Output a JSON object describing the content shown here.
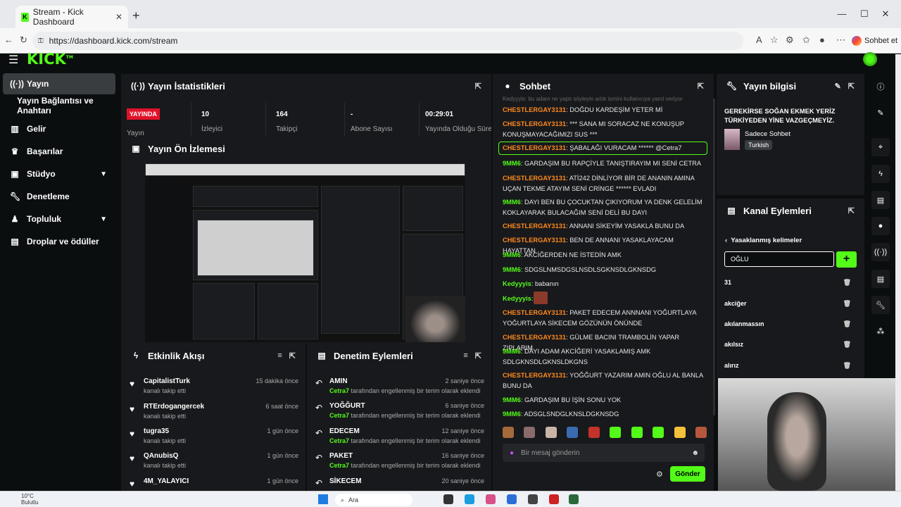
{
  "browser": {
    "tab_title": "Stream - Kick Dashboard",
    "url": "https://dashboard.kick.com/stream",
    "copilot_label": "Sohbet et"
  },
  "app": {
    "logo": "KICK"
  },
  "sidebar": {
    "items": [
      {
        "label": "Yayın",
        "icon": "broadcast-icon"
      },
      {
        "label": "Yayın Bağlantısı ve Anahtarı",
        "icon": ""
      },
      {
        "label": "Gelir",
        "icon": "revenue-icon"
      },
      {
        "label": "Başarılar",
        "icon": "trophy-icon"
      },
      {
        "label": "Stüdyo",
        "icon": "studio-icon"
      },
      {
        "label": "Denetleme",
        "icon": "wrench-icon"
      },
      {
        "label": "Topluluk",
        "icon": "community-icon"
      },
      {
        "label": "Droplar ve ödüller",
        "icon": "drops-icon"
      }
    ]
  },
  "stats": {
    "title": "Yayın İstatistikleri",
    "live_badge": "YAYINDA",
    "live_label": "Yayın",
    "items": [
      {
        "value": "10",
        "label": "İzleyici"
      },
      {
        "value": "164",
        "label": "Takipçi"
      },
      {
        "value": "-",
        "label": "Abone Sayısı"
      },
      {
        "value": "00:29:01",
        "label": "Yayında Olduğu Süre"
      }
    ]
  },
  "preview": {
    "title": "Yayın Ön İzlemesi"
  },
  "activity": {
    "title": "Etkinlik Akışı",
    "rows": [
      {
        "name": "CapitalistTurk",
        "sub": "kanalı takip etti",
        "time": "15 dakika önce"
      },
      {
        "name": "RTErdogangercek",
        "sub": "kanalı takip etti",
        "time": "6 saat önce"
      },
      {
        "name": "tugra35",
        "sub": "kanalı takip etti",
        "time": "1 gün önce"
      },
      {
        "name": "QAnubisQ",
        "sub": "kanalı takip etti",
        "time": "1 gün önce"
      },
      {
        "name": "4M_YALAYICI",
        "sub": "",
        "time": "1 gün önce"
      }
    ]
  },
  "moderation": {
    "title": "Denetim Eylemleri",
    "by": "Cetra7",
    "desc": "tarafından engellenmiş bir terim olarak eklendi",
    "rows": [
      {
        "term": "AMIN",
        "time": "2 saniye önce"
      },
      {
        "term": "YOĞĞURT",
        "time": "6 saniye önce"
      },
      {
        "term": "EDECEM",
        "time": "12 saniye önce"
      },
      {
        "term": "PAKET",
        "time": "16 saniye önce"
      },
      {
        "term": "SİKECEM",
        "time": "20 saniye önce"
      }
    ]
  },
  "chat": {
    "title": "Sohbet",
    "faded_top": "Kedyyyis: bu adam ne yaptı söyleyin artık ismini kullanıcıya yanıt veriyor",
    "messages": [
      {
        "user": "CHESTLERGAY3131",
        "color": "o",
        "text": "DOĞDU KARDEŞİM YETER Mİ"
      },
      {
        "user": "CHESTLERGAY3131",
        "color": "o",
        "text": "*** SANA MI SORACAZ NE KONUŞUP KONUŞMAYACAĞIMIZI SUS ***"
      },
      {
        "user": "CHESTLERGAY3131",
        "color": "o",
        "text": "ŞABALAĞI VURACAM ****** @Cetra7"
      },
      {
        "user": "9MM6",
        "color": "g",
        "text": "GARDAŞIM BU RAPÇİYLE TANIŞTIRAYIM MI SENİ CETRA"
      },
      {
        "user": "CHESTLERGAY3131",
        "color": "o",
        "text": "ATİ242 DİNLİYOR BİR DE ANANIN AMINA UÇAN TEKME ATAYIM SENİ CRİNGE ****** EVLADI"
      },
      {
        "user": "9MM6",
        "color": "g",
        "text": "DAYI BEN BU ÇOCUKTAN ÇIKIYORUM YA DENK GELELİM KOKLAYARAK BULACAĞIM SENİ DELİ BU DAYI"
      },
      {
        "user": "CHESTLERGAY3131",
        "color": "o",
        "text": "ANNANI SİKEYİM YASAKLA BUNU DA"
      },
      {
        "user": "CHESTLERGAY3131",
        "color": "o",
        "text": "BEN DE ANNANI YASAKLAYACAM HAYATTAN"
      },
      {
        "user": "9MM6",
        "color": "g",
        "text": "AKCİĞERDEN NE İSTEDİN AMK"
      },
      {
        "user": "9MM6",
        "color": "g",
        "text": "SDGSLNMSDGSLNSDLSGKNSDLGKNSDG"
      },
      {
        "user": "Kedyyyis",
        "color": "y",
        "text": "babanın"
      },
      {
        "user": "Kedyyyis",
        "color": "y",
        "text": ""
      },
      {
        "user": "CHESTLERGAY3131",
        "color": "o",
        "text": "PAKET EDECEM ANNNANI YOĞURTLAYA YOĞURTLAYA SİKECEM GÖZÜNÜN ÖNÜNDE"
      },
      {
        "user": "CHESTLERGAY3131",
        "color": "o",
        "text": "GÜLME BACINI TRAMBOLİN YAPAR ZIPLARIM"
      },
      {
        "user": "9MM6",
        "color": "g",
        "text": "DAYI ADAM AKCİĞERİ YASAKLAMIŞ AMK SDLGKNSDLGKNSLDKGNS"
      },
      {
        "user": "CHESTLERGAY3131",
        "color": "o",
        "text": "YOĞĞURT YAZARIM AMIN OĞLU AL BANLA BUNU DA"
      },
      {
        "user": "9MM6",
        "color": "g",
        "text": "GARDAŞIM BU İŞİN SONU YOK"
      },
      {
        "user": "9MM6",
        "color": "g",
        "text": "ADSGLSNDGLKNSLDGKNSDG"
      }
    ],
    "input_placeholder": "Bir mesaj gönderin",
    "send_label": "Gönder"
  },
  "stream_info": {
    "title": "Yayın bilgisi",
    "stream_title": "GEREKİRSE SOĞAN EKMEK YERİZ TÜRKİYEDEN YİNE VAZGEÇMEYİZ.",
    "category": "Sadece Sohbet",
    "language": "Turkish"
  },
  "channel_actions": {
    "title": "Kanal Eylemleri",
    "back_label": "Yasaklanmış kelimeler",
    "input_value": "OĞLU",
    "banned": [
      "31",
      "akciğer",
      "akılanmassın",
      "akılsız",
      "alırız"
    ]
  },
  "taskbar": {
    "weather_temp": "10°C",
    "weather_desc": "Bulutlu",
    "search_label": "Ara"
  },
  "colors": {
    "accent": "#53fc18",
    "live": "#e0122a",
    "orange_user": "#ff8a1f",
    "panel": "#18191c"
  }
}
